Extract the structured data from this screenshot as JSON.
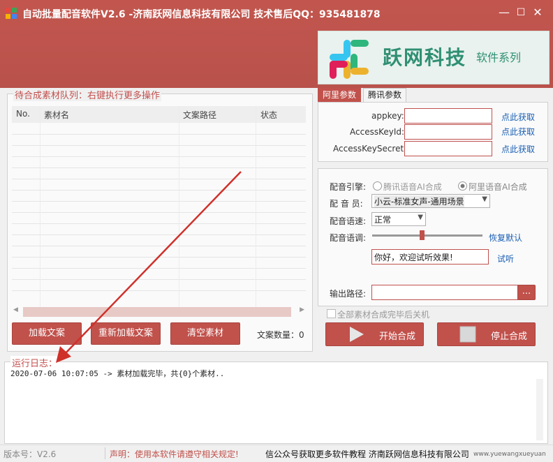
{
  "window": {
    "title": "自动批量配音软件V2.6 -济南跃网信息科技有限公司 技术售后QQ：935481878",
    "minimize_glyph": "—",
    "maximize_glyph": "☐",
    "close_glyph": "✕"
  },
  "banner": {
    "brand": "跃网科技",
    "sub": "软件系列"
  },
  "queue": {
    "legend": "待合成素材队列：右键执行更多操作",
    "columns": [
      "No.",
      "素材名",
      "文案路径",
      "状态"
    ],
    "rows": [],
    "scroll_left": "◀",
    "scroll_right": "▶"
  },
  "buttons": {
    "load": "加载文案",
    "reload": "重新加载文案",
    "clear": "清空素材",
    "count_label": "文案数量：0",
    "start": "开始合成",
    "stop": "停止合成"
  },
  "tabs": {
    "ali": "阿里参数",
    "tencent": "腾讯参数"
  },
  "ali": {
    "appkey_label": "appkey:",
    "accesskeyid_label": "AccessKeyId:",
    "accesskeysecret_label": "AccessKeySecret:",
    "appkey_value": "",
    "accesskeyid_value": "",
    "accesskeysecret_value": "",
    "get_link": "点此获取"
  },
  "voice": {
    "engine_label": "配音引擎:",
    "engine_tencent": "腾讯语音AI合成",
    "engine_ali": "阿里语音AI合成",
    "engine_selected": "ali",
    "speaker_label": "配 音 员:",
    "speaker_value": "小云-标准女声-通用场景",
    "speed_label": "配音语速:",
    "speed_value": "正常",
    "pitch_label": "配音语调:",
    "pitch_level": 0.45,
    "reset": "恢复默认",
    "preview_text": "你好，欢迎试听效果!",
    "try_listen": "试听",
    "output_label": "输出路径:",
    "output_value": "",
    "browse": "...",
    "shutdown_label": "全部素材合成完毕后关机"
  },
  "log": {
    "legend": "运行日志：",
    "lines": [
      "2020-07-06 10:07:05 -> 素材加载完毕，共{0}个素材.."
    ]
  },
  "status": {
    "version": "版本号：V2.6",
    "notice": "声明：使用本软件请遵守相关规定!",
    "marquee": "信公众号获取更多软件教程 济南跃网信息科技有限公司"
  },
  "watermark": {
    "text": "www.yuewangxueyuan"
  },
  "colors": {
    "accent": "#c1514b",
    "link": "#1a5fb4",
    "arrow": "#d0302a"
  }
}
